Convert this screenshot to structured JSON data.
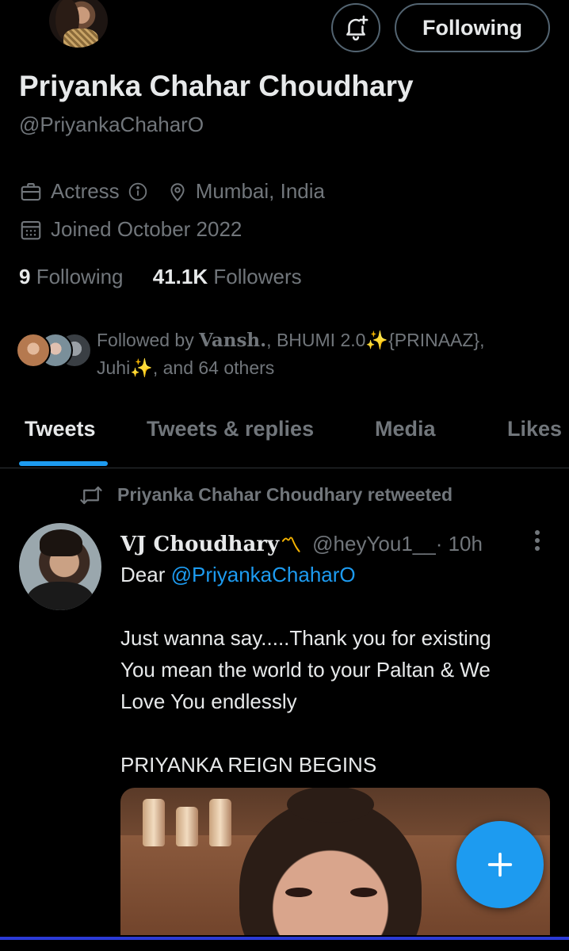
{
  "profile": {
    "name": "Priyanka Chahar Choudhary",
    "handle": "@PriyankaChaharO",
    "category": "Actress",
    "location": "Mumbai, India",
    "joined": "Joined October 2022",
    "following_count": "9",
    "following_label": " Following",
    "followers_count": "41.1K",
    "followers_label": " Followers",
    "follow_button_label": "Following",
    "followed_by_prefix": "Followed by ",
    "followed_by_user1": "Vansh.",
    "followed_by_rest_line1": ", BHUMI 2.0✨{PRINAAZ},",
    "followed_by_rest_line2": "Juhi✨, and 64 others"
  },
  "tabs": [
    {
      "label": "Tweets",
      "active": true
    },
    {
      "label": "Tweets & replies",
      "active": false
    },
    {
      "label": "Media",
      "active": false
    },
    {
      "label": "Likes",
      "active": false
    }
  ],
  "tweet": {
    "retweet_label": "Priyanka Chahar Choudhary retweeted",
    "author_name": "VJ Choudhary",
    "author_emoji": "〽",
    "author_handle": "@heyYou1__",
    "time": " · 10h",
    "line1_prefix": "Dear ",
    "mention": "@PriyankaChaharO",
    "para2_line1": "Just wanna say.....Thank you for existing",
    "para2_line2": "You mean the world to your Paltan & We",
    "para2_line3": "Love You endlessly",
    "para3": "PRIYANKA REIGN BEGINS"
  },
  "colors": {
    "background": "#000000",
    "accent": "#1d9bf0",
    "secondary_text": "#71767b",
    "primary_text": "#e7e9ea"
  },
  "icons": {
    "notification": "bell-plus-icon",
    "category": "briefcase-icon",
    "info": "info-icon",
    "location": "map-pin-icon",
    "calendar": "calendar-icon",
    "retweet": "retweet-icon",
    "more": "more-vertical-icon",
    "compose": "plus-icon"
  }
}
